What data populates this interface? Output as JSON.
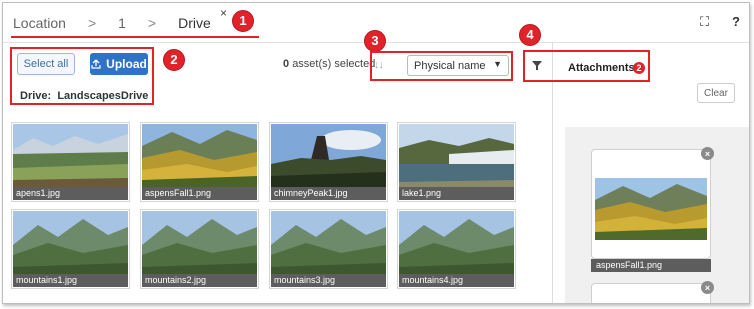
{
  "breadcrumb": {
    "items": [
      "Location",
      "1",
      "Drive"
    ],
    "separator": ">"
  },
  "header": {
    "close_glyph": "×",
    "expand_glyph": "⛶",
    "help_glyph": "?"
  },
  "callouts": [
    "1",
    "2",
    "3",
    "4"
  ],
  "toolbar": {
    "select_all_label": "Select all",
    "upload_label": "Upload",
    "selected_count": "0",
    "selected_suffix": "asset(s) selected",
    "sort_glyph": "↓↓",
    "sort_value": "Physical name",
    "drive_label": "Drive:",
    "drive_name": "LandscapesDrive"
  },
  "assets": [
    {
      "name": "apens1.jpg",
      "scene": "alpine-meadow"
    },
    {
      "name": "aspensFall1.png",
      "scene": "aspens-fall"
    },
    {
      "name": "chimneyPeak1.jpg",
      "scene": "chimney-peak"
    },
    {
      "name": "lake1.png",
      "scene": "lake"
    },
    {
      "name": "mountains1.jpg",
      "scene": "mountains"
    },
    {
      "name": "mountains2.jpg",
      "scene": "mountains"
    },
    {
      "name": "mountains3.jpg",
      "scene": "mountains"
    },
    {
      "name": "mountains4.jpg",
      "scene": "mountains"
    }
  ],
  "attachments": {
    "tab_label": "Attachments",
    "count": "2",
    "clear_label": "Clear",
    "remove_glyph": "×",
    "items": [
      {
        "name": "aspensFall1.png"
      },
      {
        "name": ""
      }
    ]
  },
  "colors": {
    "callout_red": "#e0232b",
    "primary_blue": "#2f72c6",
    "caption_bg": "#5d5d5d"
  }
}
